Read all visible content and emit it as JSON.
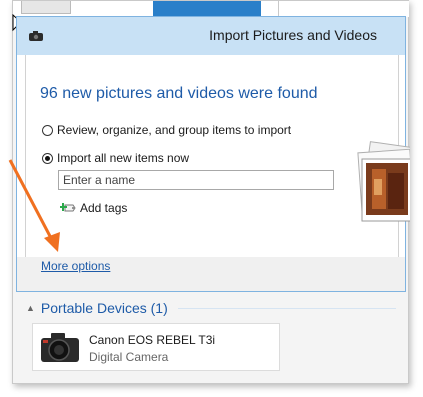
{
  "dialog": {
    "title": "Import Pictures and Videos",
    "heading": "96 new pictures and videos were found",
    "option_review": "Review, organize, and group items to import",
    "option_import_all": "Import all new items now",
    "selected_option": "import_all",
    "name_placeholder": "Enter a name",
    "name_value": "",
    "add_tags": "Add tags",
    "more_options": "More options"
  },
  "devices": {
    "section_title": "Portable Devices (1)",
    "items": [
      {
        "name": "Canon EOS REBEL T3i",
        "type": "Digital Camera",
        "icon": "dslr-camera-icon"
      }
    ]
  },
  "colors": {
    "accent_blue": "#1e5ba8",
    "titlebar": "#c8e1f5",
    "arrow": "#f07020",
    "tile_blue": "#2a7fc9"
  }
}
